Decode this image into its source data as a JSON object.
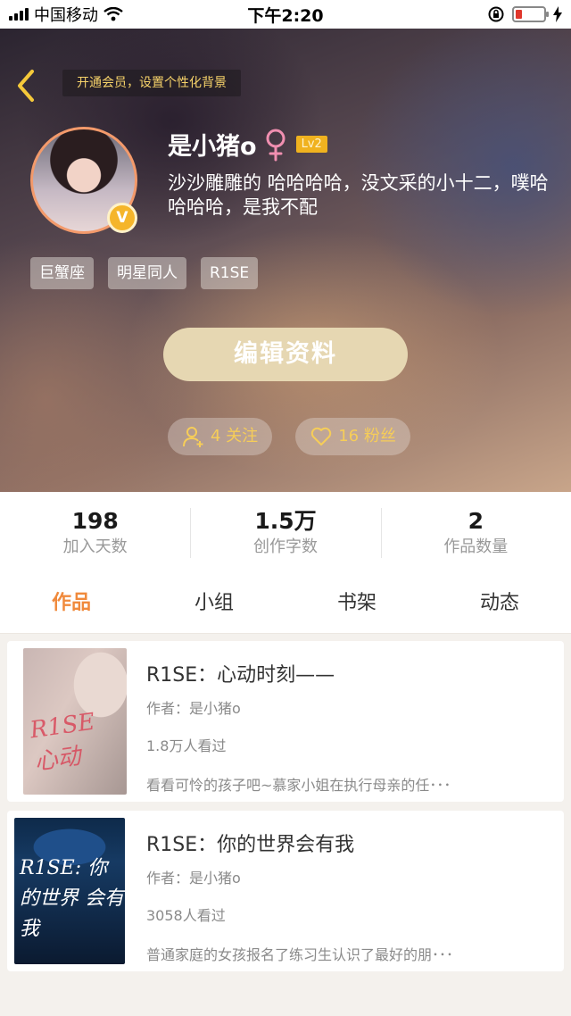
{
  "status_bar": {
    "carrier": "中国移动",
    "time": "下午2:20"
  },
  "header": {
    "member_tip": "开通会员，设置个性化背景"
  },
  "profile": {
    "username": "是小猪o",
    "gender_symbol": "♀",
    "level": "Lv2",
    "verified_badge": "V",
    "bio": "沙沙雕雕的 哈哈哈哈，没文采的小十二，噗哈哈哈哈，是我不配",
    "tags": [
      "巨蟹座",
      "明星同人",
      "R1SE"
    ],
    "edit_button": "编辑资料",
    "following": "4 关注",
    "followers": "16 粉丝"
  },
  "stats": [
    {
      "value": "198",
      "label": "加入天数"
    },
    {
      "value": "1.5万",
      "label": "创作字数"
    },
    {
      "value": "2",
      "label": "作品数量"
    }
  ],
  "tabs": [
    "作品",
    "小组",
    "书架",
    "动态"
  ],
  "active_tab": "作品",
  "books": [
    {
      "title": "R1SE：心动时刻——",
      "author": "作者：是小猪o",
      "views": "1.8万人看过",
      "description": "看看可怜的孩子吧~慕家小姐在执行母亲的任･･･",
      "cover_text": "R1SE 心动"
    },
    {
      "title": "R1SE：你的世界会有我",
      "author": "作者：是小猪o",
      "views": "3058人看过",
      "description": "普通家庭的女孩报名了练习生认识了最好的朋･･･",
      "cover_text": "R1SE: 你的世界 会有我"
    }
  ],
  "colors": {
    "accent_orange": "#f08a3c",
    "gold": "#f6cd58",
    "edit_button": "#e6d7b2",
    "battery_low": "#e0362b"
  }
}
